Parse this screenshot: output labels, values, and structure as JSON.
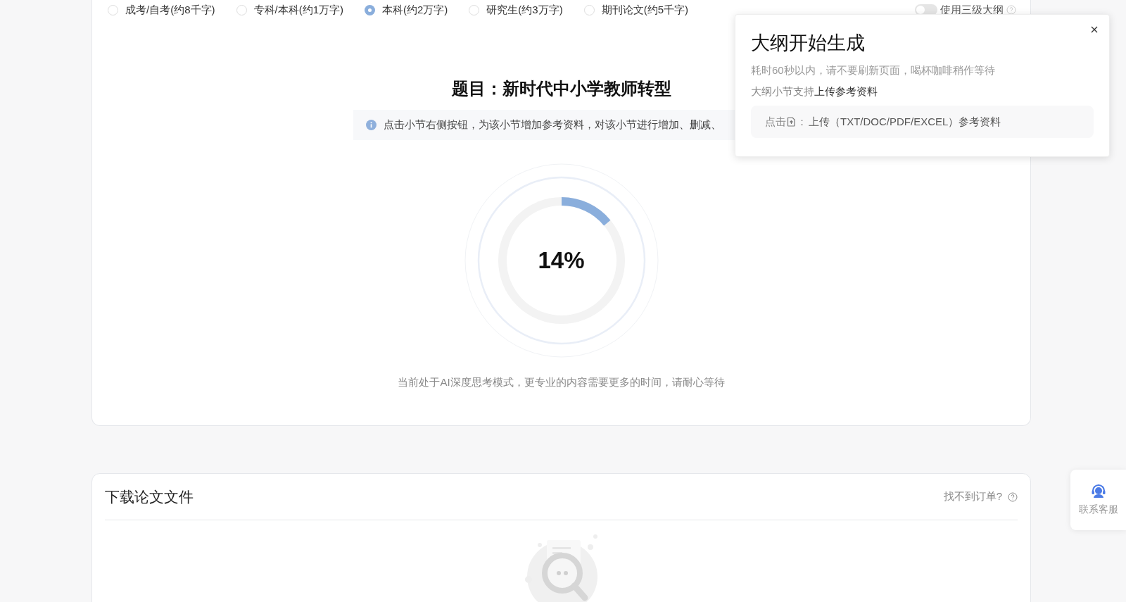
{
  "paper_types": [
    {
      "label": "成考/自考(约8千字)",
      "selected": false
    },
    {
      "label": "专科/本科(约1万字)",
      "selected": false
    },
    {
      "label": "本科(约2万字)",
      "selected": true
    },
    {
      "label": "研究生(约3万字)",
      "selected": false
    },
    {
      "label": "期刊论文(约5千字)",
      "selected": false
    }
  ],
  "outline_toggle": {
    "label": "使用三级大纲",
    "on": false
  },
  "title": "题目：新时代中小学教师转型",
  "info": "点击小节右侧按钮，为该小节增加参考资料，对该小节进行增加、删减、",
  "progress": {
    "level": 0.14,
    "reading": "14%"
  },
  "caption": "当前处于AI深度思考模式，更专业的内容需要更多的时间，请耐心等待",
  "download": {
    "title": "下载论文文件",
    "help_link": "找不到订单?"
  },
  "popup": {
    "title": "大纲开始生成",
    "line_1": "耗时60秒以内，请不要刷新页面，喝杯咖啡稍作等待",
    "line_2": "大纲小节支持**上传参考资料**",
    "hint_prefix": "点击",
    "hint_sep": "：",
    "hint_text": "上传（TXT/DOC/PDF/EXCEL）参考资料"
  },
  "support": {
    "label": "联系客服"
  }
}
